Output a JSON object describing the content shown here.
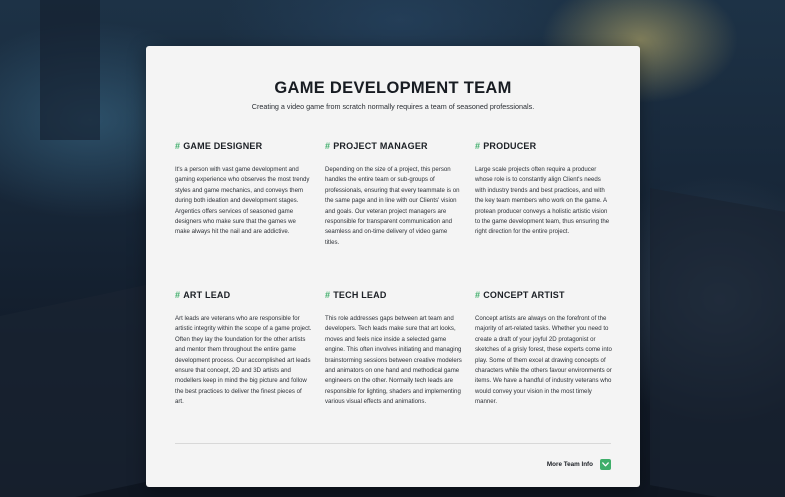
{
  "colors": {
    "accent": "#3fae6a",
    "card_background": "#f4f4f4",
    "heading_text": "#181c22"
  },
  "header": {
    "title": "GAME DEVELOPMENT TEAM",
    "subtitle": "Creating a video game from scratch normally requires a team of seasoned professionals."
  },
  "roles": [
    {
      "hash": "#",
      "title": "GAME DESIGNER",
      "description": "It's a person with vast game development and gaming experience who observes the most trendy styles and game mechanics, and conveys them during both ideation and development stages. Argentics offers services of seasoned game designers who make sure that the games we make always hit the nail and are addictive."
    },
    {
      "hash": "#",
      "title": "PROJECT MANAGER",
      "description": "Depending on the size of a project, this person handles the entire team or sub-groups of professionals, ensuring that every teammate is on the same page and in line with our Clients' vision and goals. Our veteran project managers are responsible for transparent communication and seamless and on-time delivery of video game titles."
    },
    {
      "hash": "#",
      "title": "PRODUCER",
      "description": "Large scale projects often require a producer whose role is to constantly align Client's needs with industry trends and best practices, and with the key team members who work on the game. A protean producer conveys a holistic artistic vision to the game development team, thus ensuring the right direction for the entire project."
    },
    {
      "hash": "#",
      "title": "ART LEAD",
      "description": "Art leads are veterans who are responsible for artistic integrity within the scope of a game project. Often they lay the foundation for the other artists and mentor them throughout the entire game development process. Our accomplished art leads ensure that concept, 2D and 3D artists and modellers keep in mind the big picture and follow the best practices to deliver the finest pieces of art."
    },
    {
      "hash": "#",
      "title": "TECH LEAD",
      "description": "This role addresses gaps between art team and developers. Tech leads make sure that art looks, moves and feels nice inside a selected game engine. This often involves initiating and managing brainstorming sessions between creative modelers and animators on one hand and methodical game engineers on the other. Normally tech leads are responsible for lighting, shaders and implementing various visual effects and animations."
    },
    {
      "hash": "#",
      "title": "CONCEPT ARTIST",
      "description": "Concept artists are always on the forefront of the majority of art-related tasks. Whether you need to create a draft of your joyful 2D protagonist or sketches of a grisly forest, these experts come into play. Some of them excel at drawing concepts of characters while the others favour environments or items. We have a handful of industry veterans who would convey your vision in the most timely manner."
    }
  ],
  "footer": {
    "more_label": "More Team Info",
    "more_icon": "chevron-down-icon"
  }
}
